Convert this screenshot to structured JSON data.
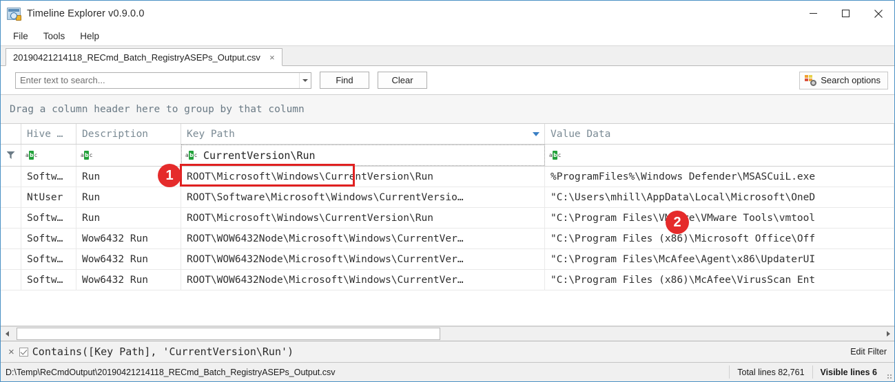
{
  "window": {
    "title": "Timeline Explorer v0.9.0.0",
    "app_icon": "timeline-explorer-icon",
    "controls": {
      "minimize": "—",
      "maximize": "☐",
      "close": "×"
    }
  },
  "menubar": {
    "items": [
      "File",
      "Tools",
      "Help"
    ]
  },
  "tabs": [
    {
      "label": "20190421214118_RECmd_Batch_RegistryASEPs_Output.csv",
      "close": "×",
      "active": true
    }
  ],
  "search": {
    "placeholder": "Enter text to search...",
    "value": "",
    "find_label": "Find",
    "clear_label": "Clear",
    "options_label": "Search options"
  },
  "group_panel": {
    "text": "Drag a column header here to group by that column"
  },
  "grid": {
    "columns": [
      {
        "key": "indicator",
        "header": ""
      },
      {
        "key": "hive",
        "header": "Hive …"
      },
      {
        "key": "description",
        "header": "Description"
      },
      {
        "key": "keypath",
        "header": "Key Path",
        "sorted": true,
        "sort_dir": "desc"
      },
      {
        "key": "valuedata",
        "header": "Value Data"
      }
    ],
    "filter_row": {
      "hive": "",
      "description": "",
      "keypath": "CurrentVersion\\Run",
      "valuedata": "",
      "icon": "abc-filter-icon"
    },
    "rows": [
      {
        "hive": "Softw…",
        "description": "Run",
        "keypath": "ROOT\\Microsoft\\Windows\\CurrentVersion\\Run",
        "valuedata": "%ProgramFiles%\\Windows Defender\\MSASCuiL.exe"
      },
      {
        "hive": "NtUser",
        "description": "Run",
        "keypath": "ROOT\\Software\\Microsoft\\Windows\\CurrentVersio…",
        "valuedata": "\"C:\\Users\\mhill\\AppData\\Local\\Microsoft\\OneD"
      },
      {
        "hive": "Softw…",
        "description": "Run",
        "keypath": "ROOT\\Microsoft\\Windows\\CurrentVersion\\Run",
        "valuedata": "\"C:\\Program Files\\VMware\\VMware Tools\\vmtool"
      },
      {
        "hive": "Softw…",
        "description": "Wow6432 Run",
        "keypath": "ROOT\\WOW6432Node\\Microsoft\\Windows\\CurrentVer…",
        "valuedata": "\"C:\\Program Files (x86)\\Microsoft Office\\Off"
      },
      {
        "hive": "Softw…",
        "description": "Wow6432 Run",
        "keypath": "ROOT\\WOW6432Node\\Microsoft\\Windows\\CurrentVer…",
        "valuedata": "\"C:\\Program Files\\McAfee\\Agent\\x86\\UpdaterUI"
      },
      {
        "hive": "Softw…",
        "description": "Wow6432 Run",
        "keypath": "ROOT\\WOW6432Node\\Microsoft\\Windows\\CurrentVer…",
        "valuedata": "\"C:\\Program Files (x86)\\McAfee\\VirusScan Ent"
      }
    ]
  },
  "filter_panel": {
    "close": "×",
    "enabled": true,
    "expression": "Contains([Key Path], 'CurrentVersion\\Run')",
    "edit_label": "Edit Filter"
  },
  "statusbar": {
    "path": "D:\\Temp\\ReCmdOutput\\20190421214118_RECmd_Batch_RegistryASEPs_Output.csv",
    "total_lines": "Total lines 82,761",
    "visible_lines": "Visible lines 6"
  },
  "annotations": [
    {
      "label": "1",
      "color": "#e52b2b"
    },
    {
      "label": "2",
      "color": "#e52b2b"
    }
  ]
}
